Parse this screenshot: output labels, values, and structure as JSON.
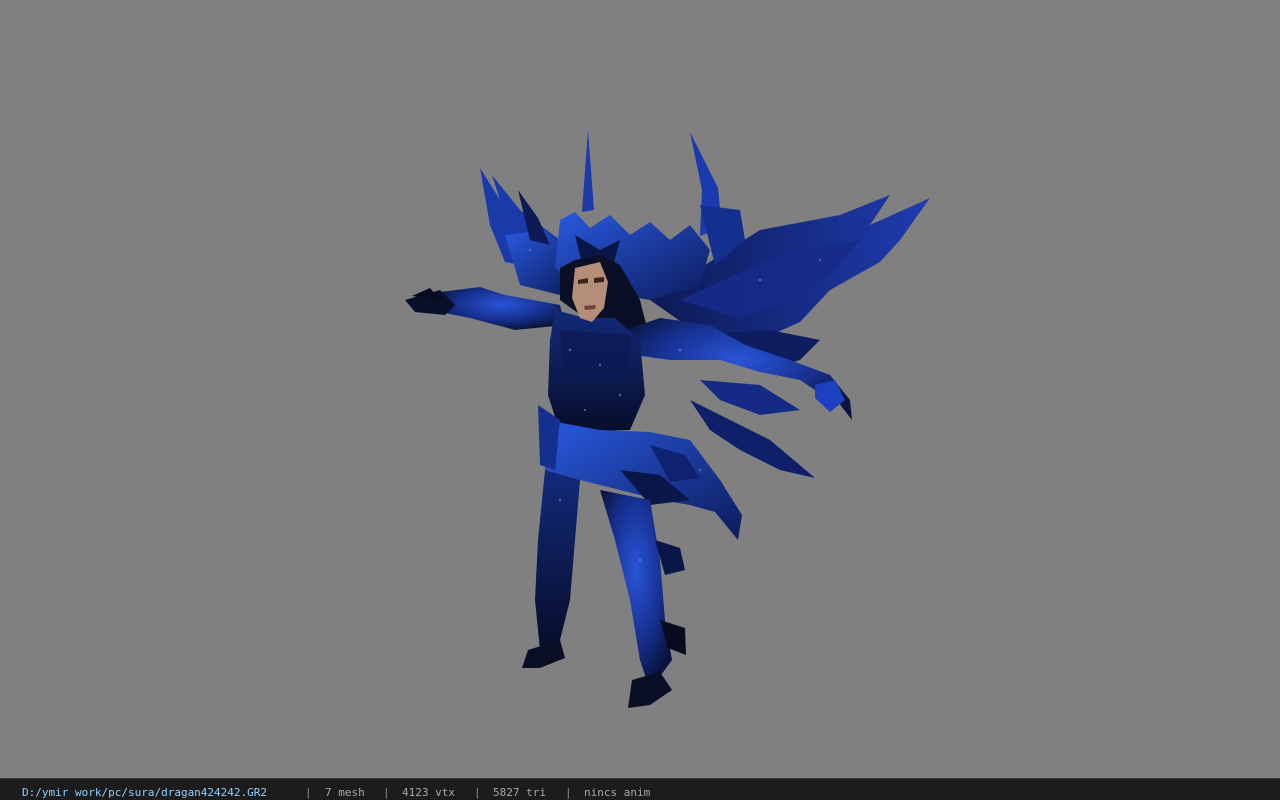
{
  "viewer": {
    "background_color": "#808080",
    "model_subject": "blue feathered armored warrior model in T-pose"
  },
  "statusbar": {
    "file_path": "D:/ymir work/pc/sura/dragan424242.GR2",
    "separator": "|",
    "mesh_count": "7 mesh",
    "vertex_count": "4123 vtx",
    "triangle_count": "5827 tri",
    "animation": "nincs anim"
  },
  "colors": {
    "armor_primary": "#1d3fb0",
    "armor_dark": "#0a1238",
    "skin": "#b58e7a",
    "statusbar_bg": "#1c1c1c",
    "path_text": "#8fd0ff"
  }
}
